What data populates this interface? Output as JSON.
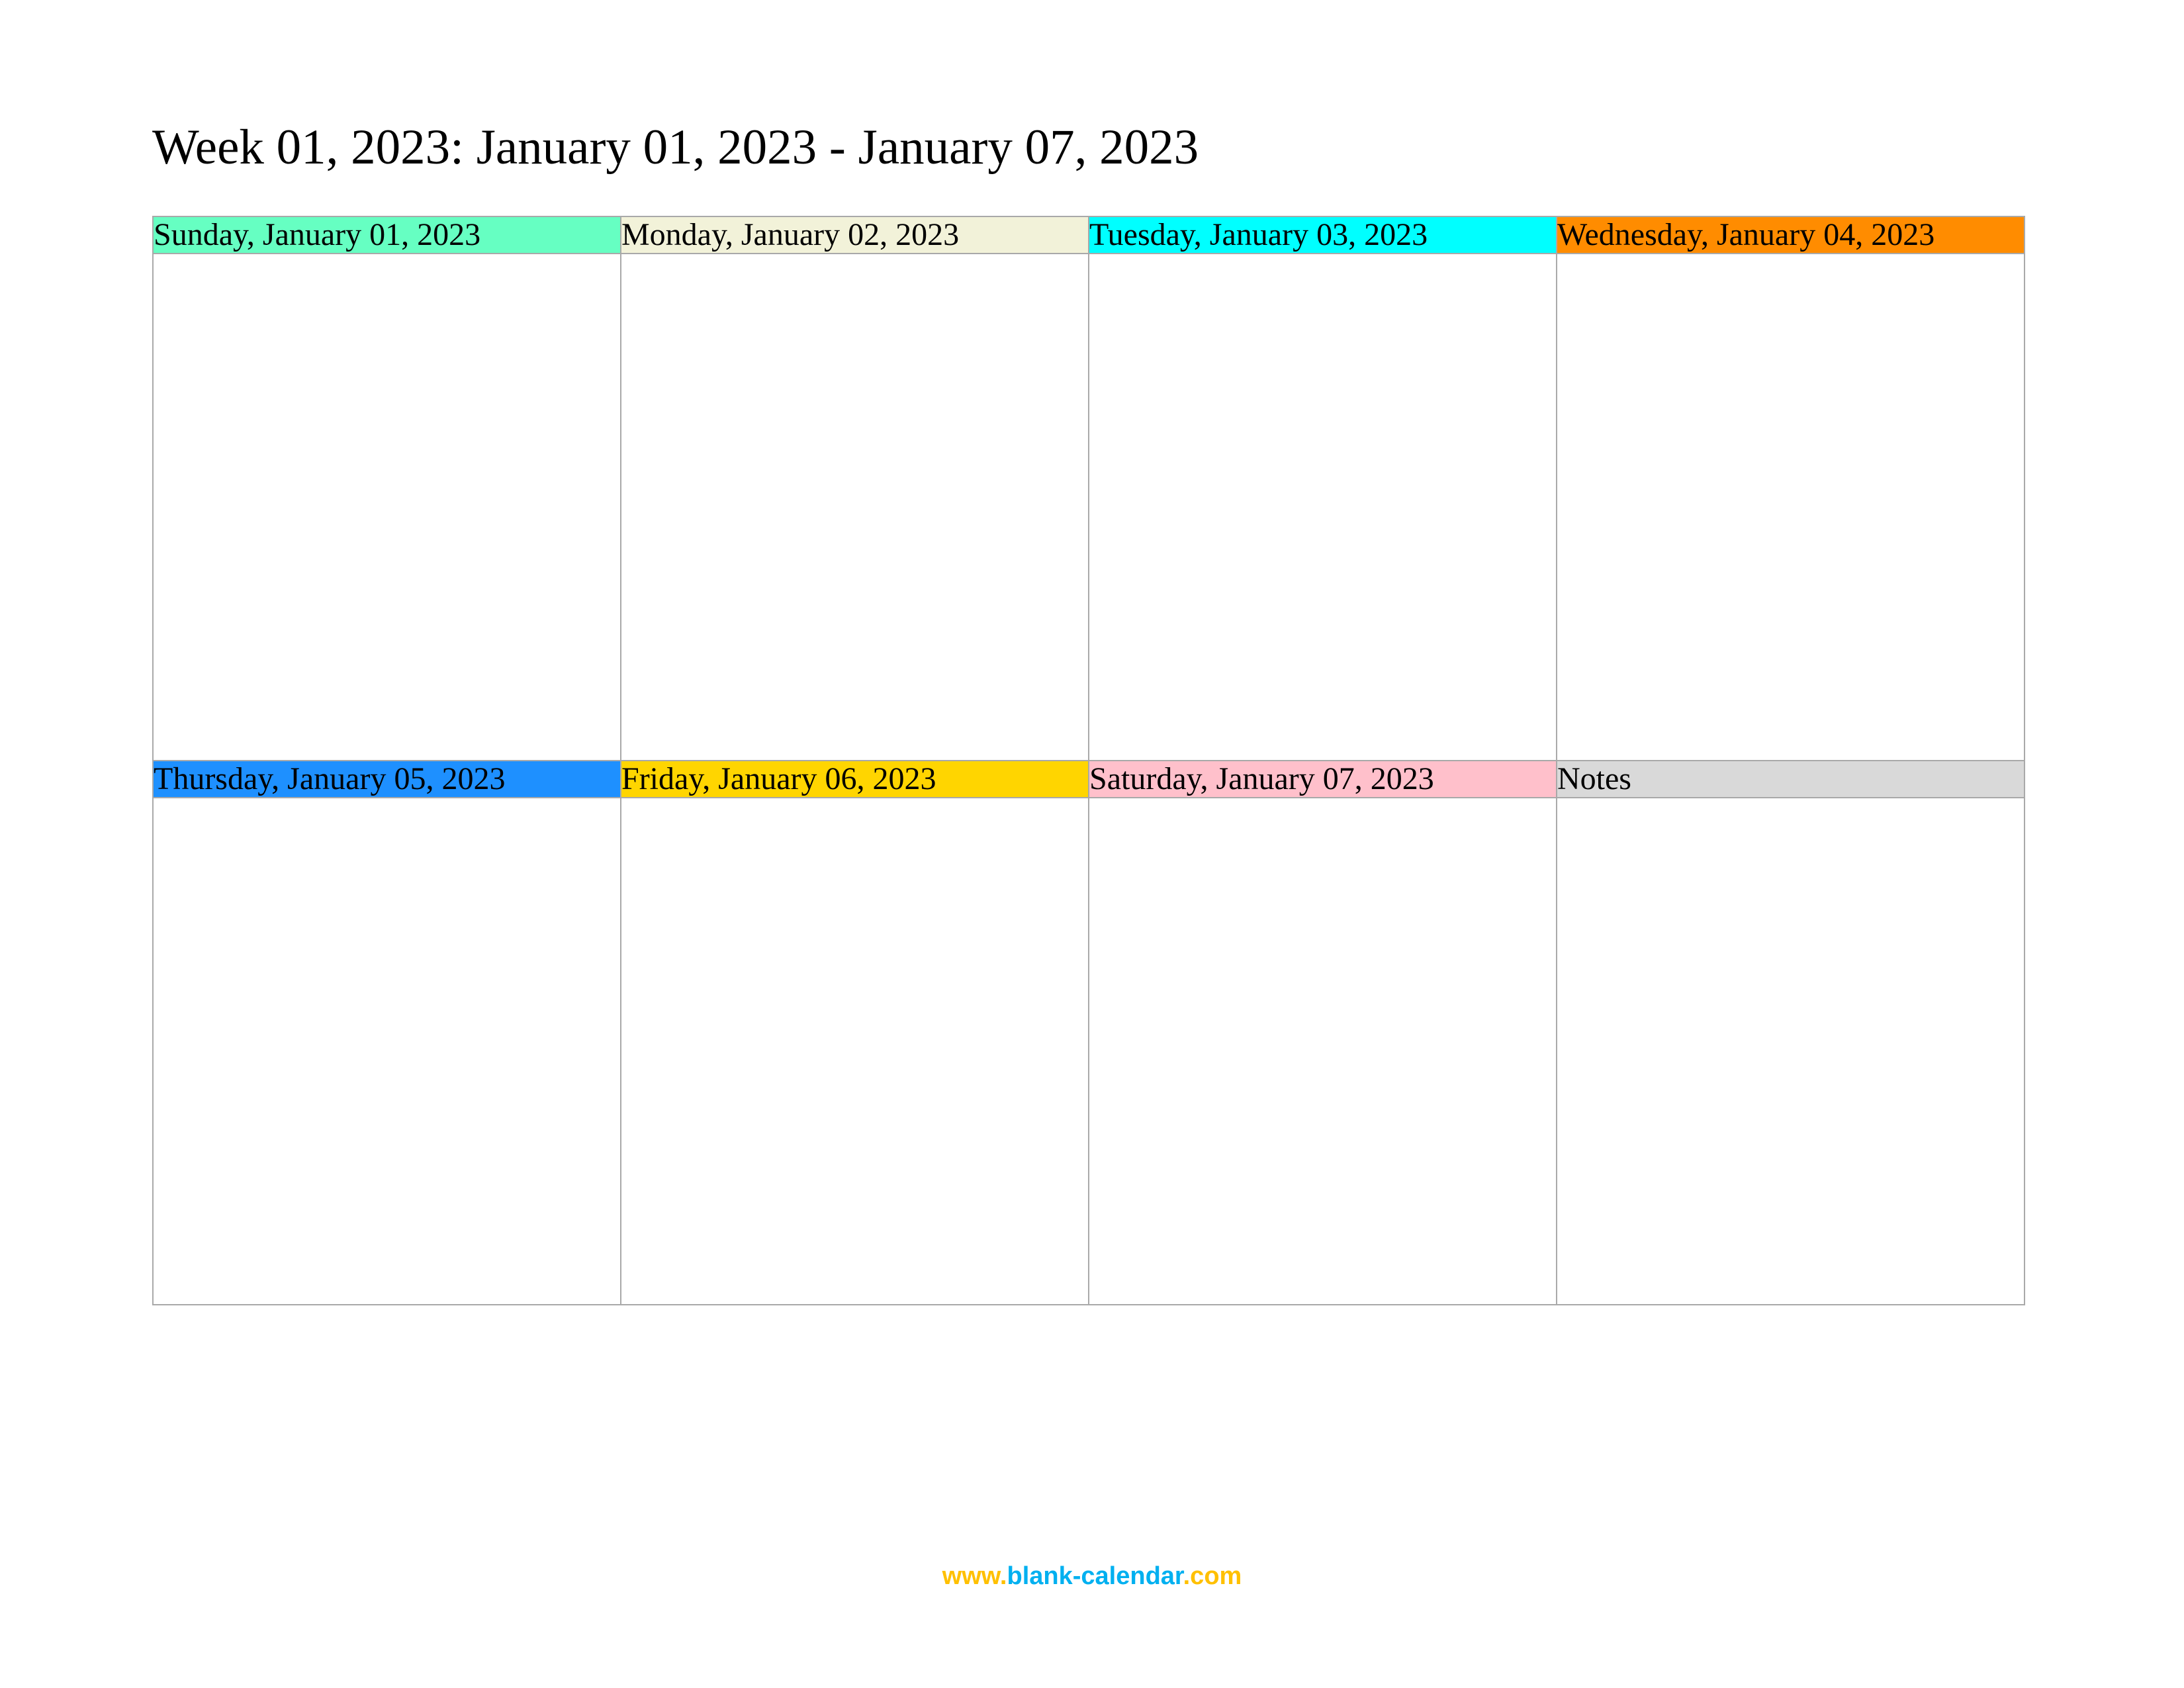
{
  "title": "Week 01, 2023: January 01, 2023 - January 07, 2023",
  "cells": [
    {
      "label": "Sunday, January 01, 2023",
      "bg": "#66ffc2"
    },
    {
      "label": "Monday, January 02, 2023",
      "bg": "#f2f2d9"
    },
    {
      "label": "Tuesday, January 03, 2023",
      "bg": "#00ffff"
    },
    {
      "label": "Wednesday, January 04, 2023",
      "bg": "#ff8c00"
    },
    {
      "label": "Thursday, January 05, 2023",
      "bg": "#1e90ff"
    },
    {
      "label": "Friday, January 06, 2023",
      "bg": "#ffd500"
    },
    {
      "label": "Saturday, January 07, 2023",
      "bg": "#ffc0cb"
    },
    {
      "label": "Notes",
      "bg": "#d9d9d9"
    }
  ],
  "footer": {
    "p1": "www.",
    "p2": "blank-calendar",
    "p3": ".com"
  }
}
